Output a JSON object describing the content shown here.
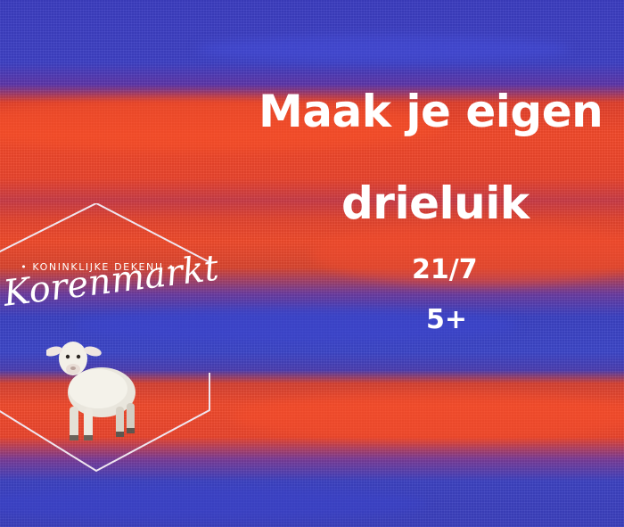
{
  "poster": {
    "title_line1": "Maak je eigen",
    "title_line2": "drieluik",
    "date": "21/7",
    "age": "5+"
  },
  "logo": {
    "organization": "KONINKLIJKE DEKENIJ",
    "name": "Korenmarkt",
    "mascot_icon": "lamb-icon"
  },
  "colors": {
    "blue": "#3b3fbd",
    "red": "#ef4a2b",
    "text": "#ffffff"
  }
}
